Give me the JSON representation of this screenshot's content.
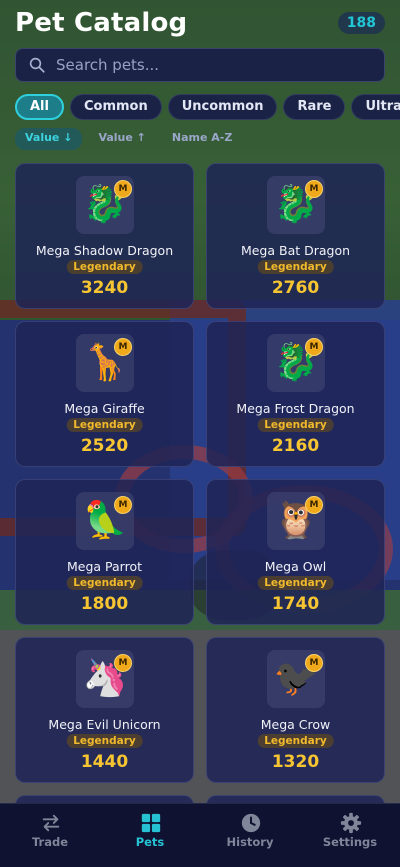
{
  "header": {
    "title": "Pet Catalog",
    "count": "188"
  },
  "search": {
    "placeholder": "Search pets...",
    "value": ""
  },
  "filters": [
    "All",
    "Common",
    "Uncommon",
    "Rare",
    "Ultra-Rare"
  ],
  "active_filter": "All",
  "sorts": [
    "Value ↓",
    "Value ↑",
    "Name A-Z"
  ],
  "active_sort": "Value ↓",
  "pets": [
    {
      "name": "Mega Shadow Dragon",
      "rarity": "Legendary",
      "value": "3240",
      "icon": "🐉",
      "badge": "M",
      "icon_name": "dragon-icon"
    },
    {
      "name": "Mega Bat Dragon",
      "rarity": "Legendary",
      "value": "2760",
      "icon": "🐉",
      "badge": "M",
      "icon_name": "dragon-icon"
    },
    {
      "name": "Mega Giraffe",
      "rarity": "Legendary",
      "value": "2520",
      "icon": "🦒",
      "badge": "M",
      "icon_name": "giraffe-icon"
    },
    {
      "name": "Mega Frost Dragon",
      "rarity": "Legendary",
      "value": "2160",
      "icon": "🐉",
      "badge": "M",
      "icon_name": "dragon-icon"
    },
    {
      "name": "Mega Parrot",
      "rarity": "Legendary",
      "value": "1800",
      "icon": "🦜",
      "badge": "M",
      "icon_name": "parrot-icon"
    },
    {
      "name": "Mega Owl",
      "rarity": "Legendary",
      "value": "1740",
      "icon": "🦉",
      "badge": "M",
      "icon_name": "owl-icon"
    },
    {
      "name": "Mega Evil Unicorn",
      "rarity": "Legendary",
      "value": "1440",
      "icon": "🦄",
      "badge": "M",
      "icon_name": "unicorn-icon"
    },
    {
      "name": "Mega Crow",
      "rarity": "Legendary",
      "value": "1320",
      "icon": "🐦‍⬛",
      "badge": "M",
      "icon_name": "crow-icon"
    }
  ],
  "nav": [
    {
      "label": "Trade",
      "icon": "swap-icon"
    },
    {
      "label": "Pets",
      "icon": "grid-icon"
    },
    {
      "label": "History",
      "icon": "clock-icon"
    },
    {
      "label": "Settings",
      "icon": "gear-icon"
    }
  ],
  "active_nav": "Pets",
  "colors": {
    "accent": "#26c2d4",
    "gold": "#f6c531",
    "card": "#1e2456",
    "nav_bg": "#0f1230"
  }
}
